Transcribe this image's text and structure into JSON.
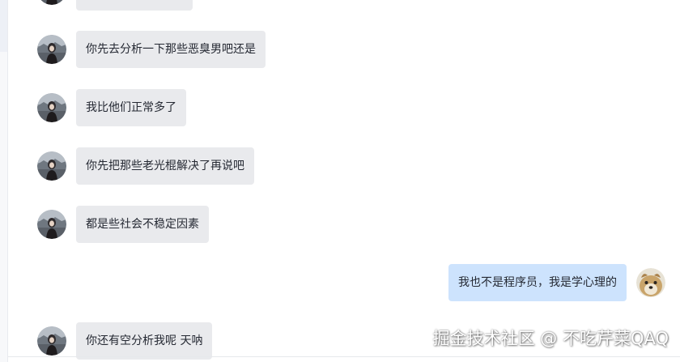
{
  "messages": [
    {
      "side": "left",
      "text": "你先去分析一下那些恶臭男吧还是"
    },
    {
      "side": "left",
      "text": "我比他们正常多了"
    },
    {
      "side": "left",
      "text": "你先把那些老光棍解决了再说吧"
    },
    {
      "side": "left",
      "text": "都是些社会不稳定因素"
    },
    {
      "side": "right",
      "text": "我也不是程序员，我是学心理的"
    },
    {
      "side": "left",
      "text": "你还有空分析我呢 天呐"
    }
  ],
  "watermark": "掘金技术社区 @ 不吃芹菜QAQ",
  "colors": {
    "incoming_bubble": "#e9eaed",
    "outgoing_bubble": "#cde3fd",
    "text": "#252933"
  }
}
